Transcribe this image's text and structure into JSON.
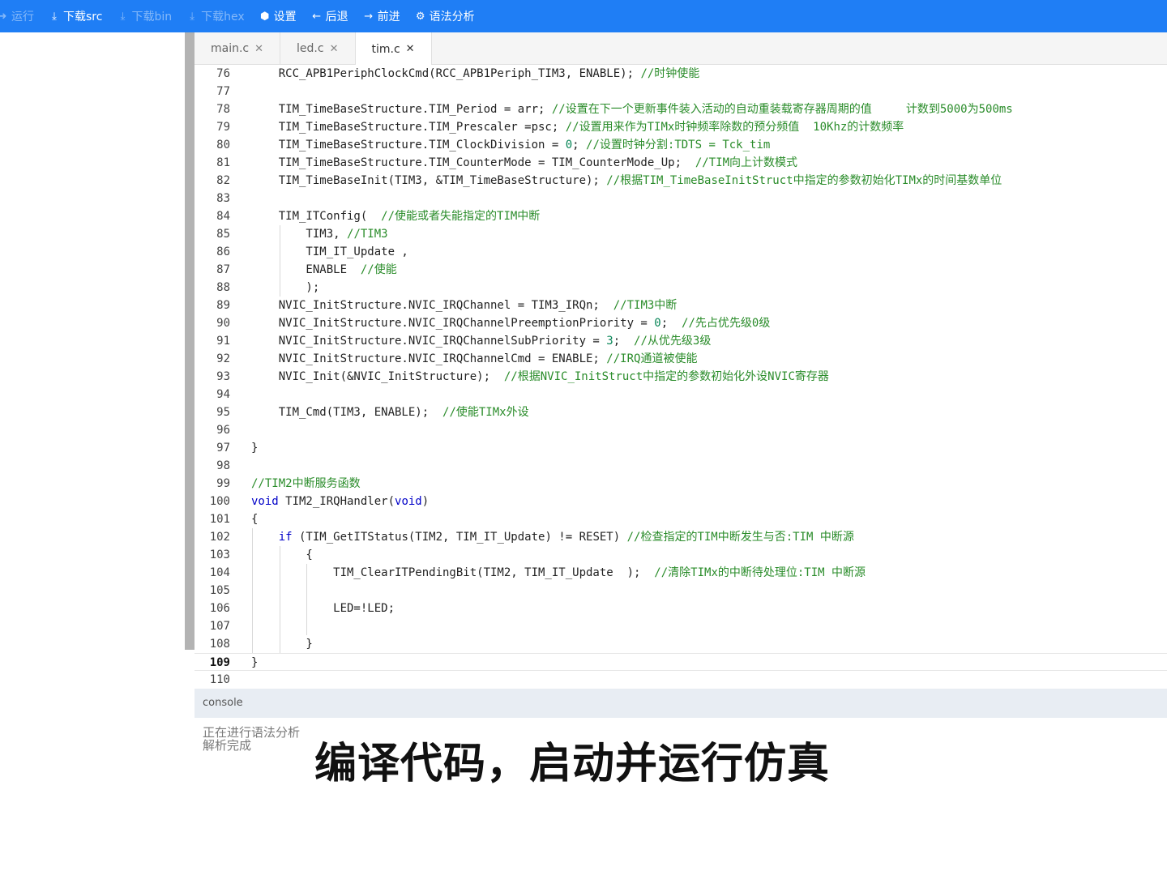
{
  "toolbar": {
    "items": [
      {
        "label": "运行",
        "icon": "play-icon",
        "enabled": false
      },
      {
        "label": "下载src",
        "icon": "download-icon",
        "enabled": true
      },
      {
        "label": "下载bin",
        "icon": "download-icon",
        "enabled": false
      },
      {
        "label": "下载hex",
        "icon": "download-icon",
        "enabled": false
      },
      {
        "label": "设置",
        "icon": "settings-icon",
        "enabled": true
      },
      {
        "label": "后退",
        "icon": "arrow-left-icon",
        "enabled": true
      },
      {
        "label": "前进",
        "icon": "arrow-right-icon",
        "enabled": true
      },
      {
        "label": "语法分析",
        "icon": "gear-icon",
        "enabled": true
      }
    ]
  },
  "tabs": [
    {
      "label": "main.c",
      "active": false
    },
    {
      "label": "led.c",
      "active": false
    },
    {
      "label": "tim.c",
      "active": true
    }
  ],
  "editor": {
    "current_line": 109,
    "lines": [
      {
        "n": "76",
        "code": "    RCC_APB1PeriphClockCmd(RCC_APB1Periph_TIM3, ENABLE); ",
        "comment": "//时钟使能"
      },
      {
        "n": "77",
        "code": "",
        "comment": ""
      },
      {
        "n": "78",
        "code": "    TIM_TimeBaseStructure.TIM_Period = arr; ",
        "comment": "//设置在下一个更新事件装入活动的自动重装载寄存器周期的值     计数到5000为500ms"
      },
      {
        "n": "79",
        "code": "    TIM_TimeBaseStructure.TIM_Prescaler =psc; ",
        "comment": "//设置用来作为TIMx时钟频率除数的预分频值  10Khz的计数频率"
      },
      {
        "n": "80",
        "code": "    TIM_TimeBaseStructure.TIM_ClockDivision = 0; ",
        "comment": "//设置时钟分割:TDTS = Tck_tim"
      },
      {
        "n": "81",
        "code": "    TIM_TimeBaseStructure.TIM_CounterMode = TIM_CounterMode_Up;  ",
        "comment": "//TIM向上计数模式"
      },
      {
        "n": "82",
        "code": "    TIM_TimeBaseInit(TIM3, &TIM_TimeBaseStructure); ",
        "comment": "//根据TIM_TimeBaseInitStruct中指定的参数初始化TIMx的时间基数单位"
      },
      {
        "n": "83",
        "code": "",
        "comment": ""
      },
      {
        "n": "84",
        "code": "    TIM_ITConfig(  ",
        "comment": "//使能或者失能指定的TIM中断"
      },
      {
        "n": "85",
        "code": "        TIM3, ",
        "comment": "//TIM3"
      },
      {
        "n": "86",
        "code": "        TIM_IT_Update ,",
        "comment": ""
      },
      {
        "n": "87",
        "code": "        ENABLE  ",
        "comment": "//使能"
      },
      {
        "n": "88",
        "code": "        );",
        "comment": ""
      },
      {
        "n": "89",
        "code": "    NVIC_InitStructure.NVIC_IRQChannel = TIM3_IRQn;  ",
        "comment": "//TIM3中断"
      },
      {
        "n": "90",
        "code": "    NVIC_InitStructure.NVIC_IRQChannelPreemptionPriority = 0;  ",
        "comment": "//先占优先级0级"
      },
      {
        "n": "91",
        "code": "    NVIC_InitStructure.NVIC_IRQChannelSubPriority = 3;  ",
        "comment": "//从优先级3级"
      },
      {
        "n": "92",
        "code": "    NVIC_InitStructure.NVIC_IRQChannelCmd = ENABLE; ",
        "comment": "//IRQ通道被使能"
      },
      {
        "n": "93",
        "code": "    NVIC_Init(&NVIC_InitStructure);  ",
        "comment": "//根据NVIC_InitStruct中指定的参数初始化外设NVIC寄存器"
      },
      {
        "n": "94",
        "code": "",
        "comment": ""
      },
      {
        "n": "95",
        "code": "    TIM_Cmd(TIM3, ENABLE);  ",
        "comment": "//使能TIMx外设"
      },
      {
        "n": "96",
        "code": "",
        "comment": ""
      },
      {
        "n": "97",
        "code": "}",
        "comment": ""
      },
      {
        "n": "98",
        "code": "",
        "comment": ""
      },
      {
        "n": "99",
        "code": "",
        "comment": "//TIM2中断服务函数"
      },
      {
        "n": "100",
        "code": "void TIM2_IRQHandler(void)",
        "comment": ""
      },
      {
        "n": "101",
        "code": "{",
        "comment": ""
      },
      {
        "n": "102",
        "code": "    if (TIM_GetITStatus(TIM2, TIM_IT_Update) != RESET) ",
        "comment": "//检查指定的TIM中断发生与否:TIM 中断源"
      },
      {
        "n": "103",
        "code": "        {",
        "comment": ""
      },
      {
        "n": "104",
        "code": "            TIM_ClearITPendingBit(TIM2, TIM_IT_Update  );  ",
        "comment": "//清除TIMx的中断待处理位:TIM 中断源"
      },
      {
        "n": "105",
        "code": "",
        "comment": ""
      },
      {
        "n": "106",
        "code": "            LED=!LED;",
        "comment": ""
      },
      {
        "n": "107",
        "code": "",
        "comment": ""
      },
      {
        "n": "108",
        "code": "        }",
        "comment": ""
      },
      {
        "n": "109",
        "code": "}",
        "comment": ""
      },
      {
        "n": "110",
        "code": "",
        "comment": ""
      }
    ]
  },
  "console": {
    "title": "console",
    "lines": [
      "正在进行语法分析",
      "解析完成"
    ]
  },
  "subtitle": "编译代码，启动并运行仿真"
}
